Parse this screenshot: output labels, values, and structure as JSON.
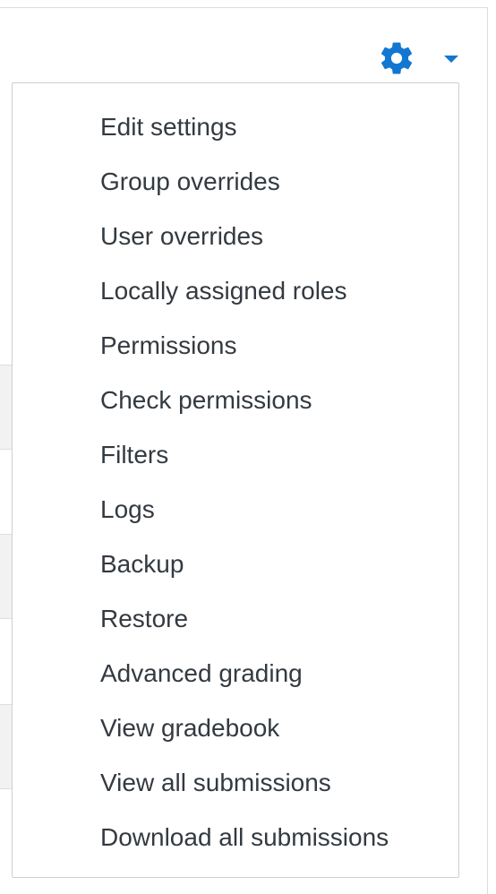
{
  "header": {
    "actions_icon": "gear-icon",
    "dropdown_icon": "caret-down-icon",
    "accent_color": "#1177d1"
  },
  "menu": {
    "items": [
      {
        "label": "Edit settings"
      },
      {
        "label": "Group overrides"
      },
      {
        "label": "User overrides"
      },
      {
        "label": "Locally assigned roles"
      },
      {
        "label": "Permissions"
      },
      {
        "label": "Check permissions"
      },
      {
        "label": "Filters"
      },
      {
        "label": "Logs"
      },
      {
        "label": "Backup"
      },
      {
        "label": "Restore"
      },
      {
        "label": "Advanced grading"
      },
      {
        "label": "View gradebook"
      },
      {
        "label": "View all submissions"
      },
      {
        "label": "Download all submissions"
      }
    ]
  }
}
